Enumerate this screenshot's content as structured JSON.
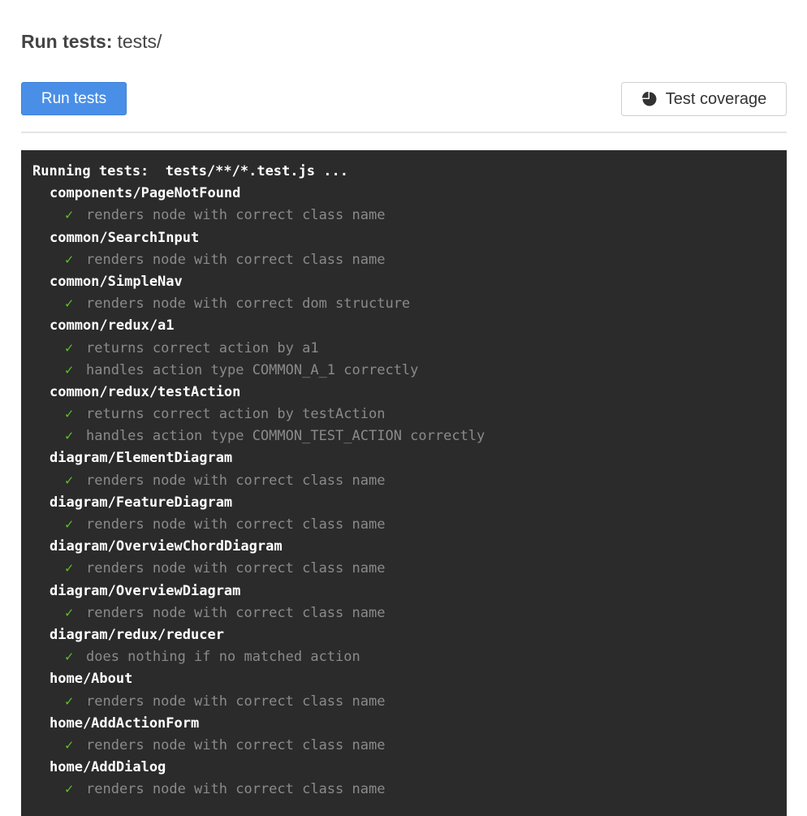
{
  "header": {
    "title_label": "Run tests:",
    "title_path": "tests/"
  },
  "toolbar": {
    "run_label": "Run tests",
    "coverage_label": "Test coverage",
    "coverage_icon": "pie-chart-icon"
  },
  "console": {
    "header": "Running tests:  tests/**/*.test.js ...",
    "check_glyph": "✓",
    "suites": [
      {
        "name": "components/PageNotFound",
        "cases": [
          "renders node with correct class name"
        ]
      },
      {
        "name": "common/SearchInput",
        "cases": [
          "renders node with correct class name"
        ]
      },
      {
        "name": "common/SimpleNav",
        "cases": [
          "renders node with correct dom structure"
        ]
      },
      {
        "name": "common/redux/a1",
        "cases": [
          "returns correct action by a1",
          "handles action type COMMON_A_1 correctly"
        ]
      },
      {
        "name": "common/redux/testAction",
        "cases": [
          "returns correct action by testAction",
          "handles action type COMMON_TEST_ACTION correctly"
        ]
      },
      {
        "name": "diagram/ElementDiagram",
        "cases": [
          "renders node with correct class name"
        ]
      },
      {
        "name": "diagram/FeatureDiagram",
        "cases": [
          "renders node with correct class name"
        ]
      },
      {
        "name": "diagram/OverviewChordDiagram",
        "cases": [
          "renders node with correct class name"
        ]
      },
      {
        "name": "diagram/OverviewDiagram",
        "cases": [
          "renders node with correct class name"
        ]
      },
      {
        "name": "diagram/redux/reducer",
        "cases": [
          "does nothing if no matched action"
        ]
      },
      {
        "name": "home/About",
        "cases": [
          "renders node with correct class name"
        ]
      },
      {
        "name": "home/AddActionForm",
        "cases": [
          "renders node with correct class name"
        ]
      },
      {
        "name": "home/AddDialog",
        "cases": [
          "renders node with correct class name"
        ]
      }
    ]
  },
  "colors": {
    "primary": "#4a8fe7",
    "console_bg": "#2b2b2b",
    "pass": "#5fbf2a",
    "case_text": "#8a8a8a"
  }
}
